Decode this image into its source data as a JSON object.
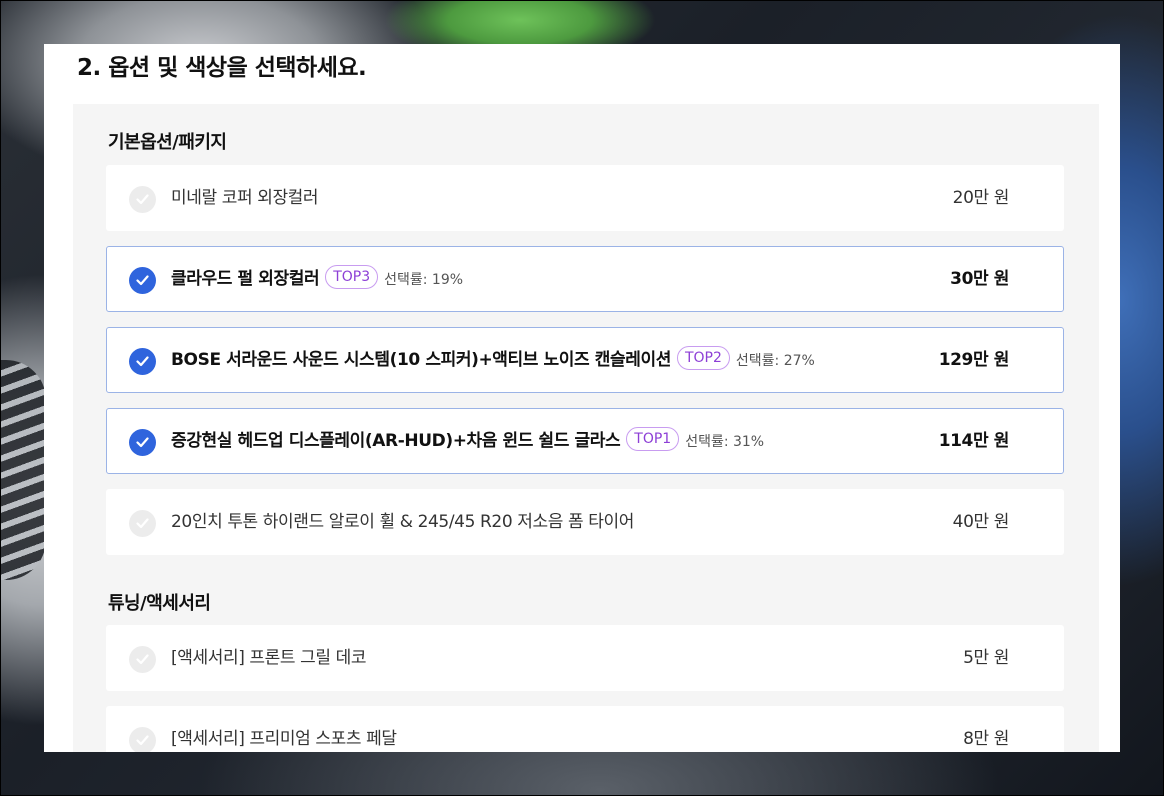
{
  "step": {
    "title": "2. 옵션 및 색상을 선택하세요."
  },
  "groups": [
    {
      "title": "기본옵션/패키지",
      "options": [
        {
          "label": "미네랄 코퍼 외장컬러",
          "price": "20만 원",
          "selected": false
        },
        {
          "label": "클라우드 펄 외장컬러",
          "badge": "TOP3",
          "rate": "선택률: 19%",
          "price": "30만 원",
          "selected": true
        },
        {
          "label": "BOSE 서라운드 사운드 시스템(10 스피커)+액티브 노이즈 캔슬레이션",
          "badge": "TOP2",
          "rate": "선택률: 27%",
          "price": "129만 원",
          "selected": true
        },
        {
          "label": "증강현실 헤드업 디스플레이(AR-HUD)+차음 윈드 쉴드 글라스",
          "badge": "TOP1",
          "rate": "선택률: 31%",
          "price": "114만 원",
          "selected": true
        },
        {
          "label": "20인치 투톤 하이랜드 알로이 휠 & 245/45 R20 저소음 폼 타이어",
          "price": "40만 원",
          "selected": false
        }
      ]
    },
    {
      "title": "튜닝/액세서리",
      "options": [
        {
          "label": "[액세서리] 프론트 그릴 데코",
          "price": "5만 원",
          "selected": false
        },
        {
          "label": "[액세서리] 프리미엄 스포츠 페달",
          "price": "8만 원",
          "selected": false
        }
      ]
    }
  ],
  "colors": {
    "accent": "#2f64dd",
    "badge": "#8d3fd6",
    "selected_border": "#9bb3e6"
  },
  "icons": {
    "check": "checkmark-icon"
  }
}
